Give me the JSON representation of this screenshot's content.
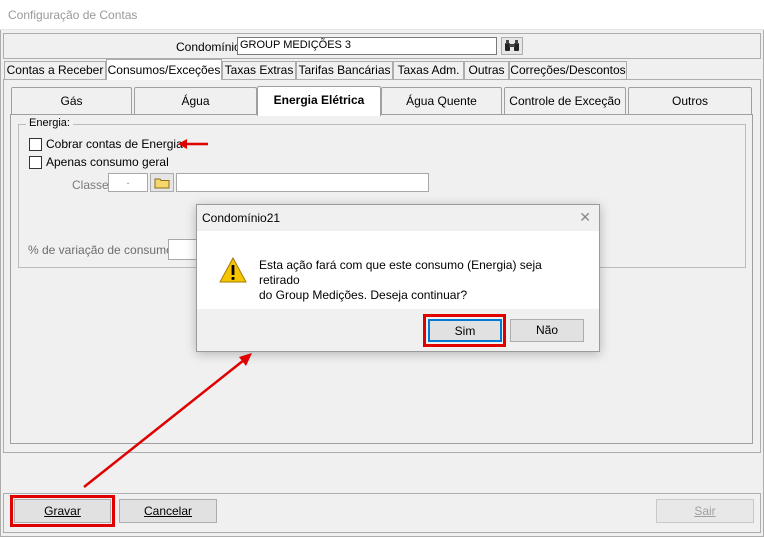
{
  "window": {
    "title": "Configuração de Contas"
  },
  "header": {
    "condominio_label": "Condomínio:",
    "condominio_value": "GROUP MEDIÇÕES 3",
    "search_icon": "binoculars-icon"
  },
  "top_tabs": [
    {
      "label": "Contas a Receber"
    },
    {
      "label": "Consumos/Exceções"
    },
    {
      "label": "Taxas Extras"
    },
    {
      "label": "Tarifas Bancárias"
    },
    {
      "label": "Taxas Adm."
    },
    {
      "label": "Outras"
    },
    {
      "label": "Correções/Descontos"
    }
  ],
  "sub_tabs": [
    {
      "label": "Gás"
    },
    {
      "label": "Água"
    },
    {
      "label": "Energia Elétrica"
    },
    {
      "label": "Água Quente"
    },
    {
      "label": "Controle de Exceção"
    },
    {
      "label": "Outros"
    }
  ],
  "energia": {
    "group_label": "Energia:",
    "cobrar_label": "Cobrar contas de Energia",
    "apenas_label": "Apenas consumo geral",
    "classe_label": "Classe:",
    "classe_value": ".",
    "folder_icon": "folder-icon",
    "variacao_label": "% de variação de consumo"
  },
  "dialog": {
    "title": "Condomínio21",
    "close_icon": "close-icon",
    "warning_icon": "warning-icon",
    "message_line1": "Esta ação fará com que este consumo (Energia) seja retirado",
    "message_line2": "do Group Medições. Deseja continuar?",
    "yes_label": "Sim",
    "no_label": "Não"
  },
  "footer": {
    "save_label": "Gravar",
    "cancel_label": "Cancelar",
    "exit_label": "Sair"
  },
  "colors": {
    "highlight": "#e00000",
    "accent": "#0078d7"
  }
}
